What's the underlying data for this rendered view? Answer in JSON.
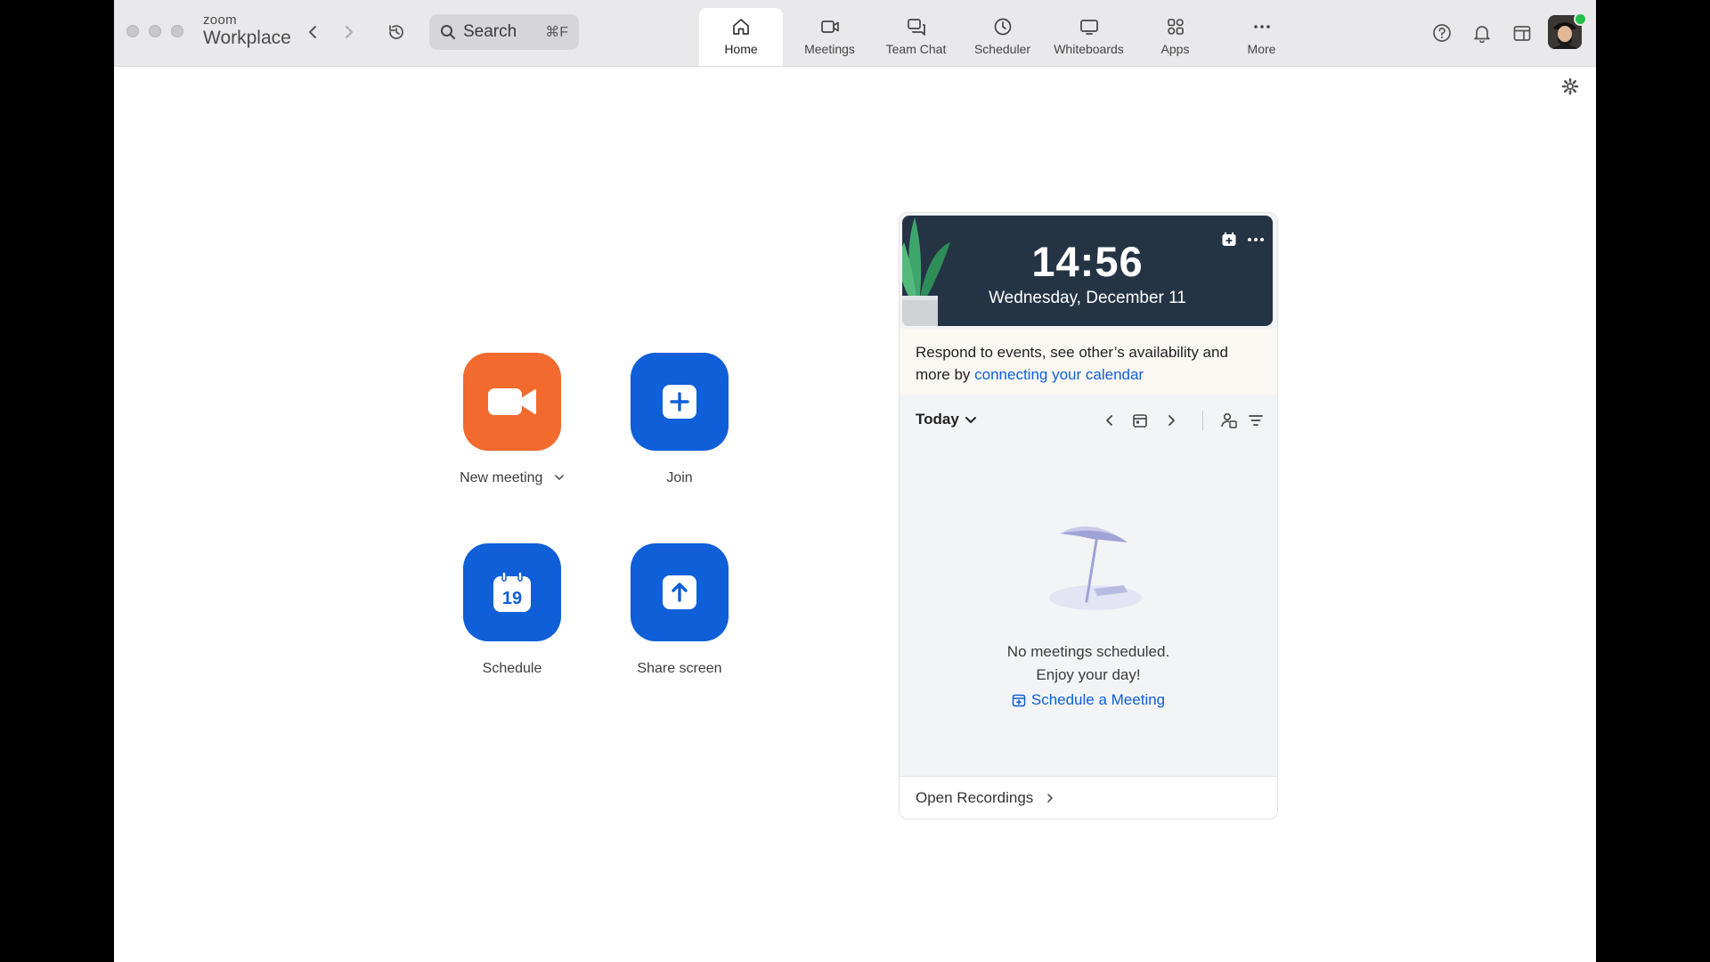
{
  "app": {
    "brand_small": "zoom",
    "brand_big": "Workplace"
  },
  "search": {
    "label": "Search",
    "shortcut": "⌘F"
  },
  "tabs": [
    {
      "label": "Home",
      "icon": "home-icon",
      "active": true
    },
    {
      "label": "Meetings",
      "icon": "video-icon"
    },
    {
      "label": "Team Chat",
      "icon": "chat-icon"
    },
    {
      "label": "Scheduler",
      "icon": "clock-icon"
    },
    {
      "label": "Whiteboards",
      "icon": "whiteboard-icon"
    },
    {
      "label": "Apps",
      "icon": "apps-icon"
    },
    {
      "label": "More",
      "icon": "more-icon"
    }
  ],
  "actions": {
    "new_meeting": "New meeting",
    "join": "Join",
    "schedule": "Schedule",
    "schedule_day": "19",
    "share_screen": "Share screen"
  },
  "calendar": {
    "time": "14:56",
    "date": "Wednesday, December 11",
    "promo_text": "Respond to events, see other’s availability and more by ",
    "promo_link": "connecting your calendar",
    "today_label": "Today",
    "empty_line1": "No meetings scheduled.",
    "empty_line2": "Enjoy your day!",
    "schedule_link": "Schedule a Meeting",
    "open_recordings": "Open Recordings"
  },
  "colors": {
    "accent_blue": "#0e5fd8",
    "new_meeting_orange": "#f26a2e",
    "clock_bg": "#253445",
    "presence_green": "#27c14a"
  }
}
